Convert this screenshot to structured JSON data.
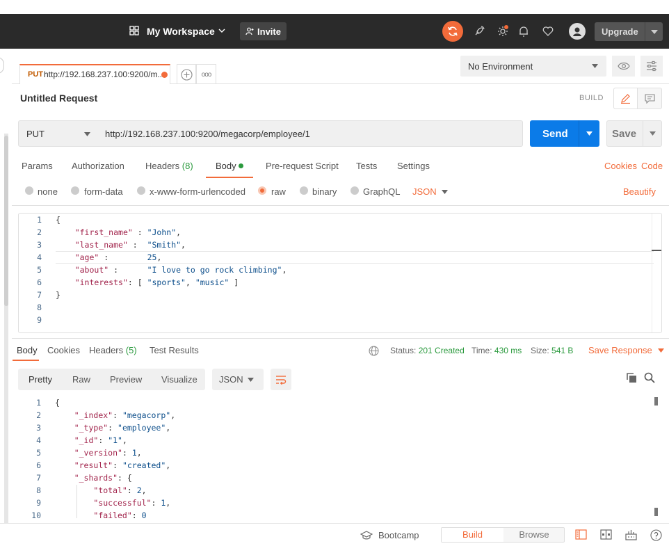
{
  "topbar": {
    "workspace_label": "My Workspace",
    "invite_label": "Invite",
    "upgrade_label": "Upgrade"
  },
  "tabs": [
    {
      "method": "PUT",
      "url": "http://192.168.237.100:9200/m..."
    }
  ],
  "tab_more": "ooo",
  "environment": {
    "selected": "No Environment"
  },
  "request": {
    "title": "Untitled Request",
    "build_label": "BUILD",
    "method": "PUT",
    "url": "http://192.168.237.100:9200/megacorp/employee/1",
    "send_label": "Send",
    "save_label": "Save"
  },
  "request_tabs": {
    "params": "Params",
    "authorization": "Authorization",
    "headers": "Headers",
    "headers_count": "(8)",
    "body": "Body",
    "prerequest": "Pre-request Script",
    "tests": "Tests",
    "settings": "Settings",
    "cookies": "Cookies",
    "code": "Code"
  },
  "body_types": {
    "none": "none",
    "form_data": "form-data",
    "urlencoded": "x-www-form-urlencoded",
    "raw": "raw",
    "binary": "binary",
    "graphql": "GraphQL",
    "language": "JSON",
    "beautify": "Beautify"
  },
  "request_body_lines": [
    {
      "n": "1",
      "parts": [
        [
          "p",
          "{"
        ]
      ]
    },
    {
      "n": "2",
      "parts": [
        [
          "p",
          "    "
        ],
        [
          "k",
          "\"first_name\""
        ],
        [
          "p",
          " : "
        ],
        [
          "s",
          "\"John\""
        ],
        [
          "p",
          ","
        ]
      ]
    },
    {
      "n": "3",
      "parts": [
        [
          "p",
          "    "
        ],
        [
          "k",
          "\"last_name\""
        ],
        [
          "p",
          " :  "
        ],
        [
          "s",
          "\"Smith\""
        ],
        [
          "p",
          ","
        ]
      ]
    },
    {
      "n": "4",
      "parts": [
        [
          "p",
          "    "
        ],
        [
          "k",
          "\"age\""
        ],
        [
          "p",
          " :        "
        ],
        [
          "n",
          "25"
        ],
        [
          "p",
          ","
        ]
      ]
    },
    {
      "n": "5",
      "parts": [
        [
          "p",
          "    "
        ],
        [
          "k",
          "\"about\""
        ],
        [
          "p",
          " :      "
        ],
        [
          "s",
          "\"I love to go rock climbing\""
        ],
        [
          "p",
          ","
        ]
      ]
    },
    {
      "n": "6",
      "parts": [
        [
          "p",
          "    "
        ],
        [
          "k",
          "\"interests\""
        ],
        [
          "p",
          ": [ "
        ],
        [
          "s",
          "\"sports\""
        ],
        [
          "p",
          ", "
        ],
        [
          "s",
          "\"music\""
        ],
        [
          "p",
          " ]"
        ]
      ]
    },
    {
      "n": "7",
      "parts": [
        [
          "p",
          "}"
        ]
      ]
    },
    {
      "n": "8",
      "parts": []
    },
    {
      "n": "9",
      "parts": []
    }
  ],
  "response_tabs": {
    "body": "Body",
    "cookies": "Cookies",
    "headers": "Headers",
    "headers_count": "(5)",
    "test_results": "Test Results"
  },
  "response_meta": {
    "status_label": "Status:",
    "status_value": "201 Created",
    "time_label": "Time:",
    "time_value": "430 ms",
    "size_label": "Size:",
    "size_value": "541 B",
    "save_response": "Save Response"
  },
  "response_view": {
    "pretty": "Pretty",
    "raw": "Raw",
    "preview": "Preview",
    "visualize": "Visualize",
    "format": "JSON"
  },
  "response_body_lines": [
    {
      "n": "1",
      "parts": [
        [
          "p",
          "{"
        ]
      ]
    },
    {
      "n": "2",
      "parts": [
        [
          "p",
          "    "
        ],
        [
          "k",
          "\"_index\""
        ],
        [
          "p",
          ": "
        ],
        [
          "s",
          "\"megacorp\""
        ],
        [
          "p",
          ","
        ]
      ]
    },
    {
      "n": "3",
      "parts": [
        [
          "p",
          "    "
        ],
        [
          "k",
          "\"_type\""
        ],
        [
          "p",
          ": "
        ],
        [
          "s",
          "\"employee\""
        ],
        [
          "p",
          ","
        ]
      ]
    },
    {
      "n": "4",
      "parts": [
        [
          "p",
          "    "
        ],
        [
          "k",
          "\"_id\""
        ],
        [
          "p",
          ": "
        ],
        [
          "s",
          "\"1\""
        ],
        [
          "p",
          ","
        ]
      ]
    },
    {
      "n": "5",
      "parts": [
        [
          "p",
          "    "
        ],
        [
          "k",
          "\"_version\""
        ],
        [
          "p",
          ": "
        ],
        [
          "n",
          "1"
        ],
        [
          "p",
          ","
        ]
      ]
    },
    {
      "n": "6",
      "parts": [
        [
          "p",
          "    "
        ],
        [
          "k",
          "\"result\""
        ],
        [
          "p",
          ": "
        ],
        [
          "s",
          "\"created\""
        ],
        [
          "p",
          ","
        ]
      ]
    },
    {
      "n": "7",
      "parts": [
        [
          "p",
          "    "
        ],
        [
          "k",
          "\"_shards\""
        ],
        [
          "p",
          ": {"
        ]
      ]
    },
    {
      "n": "8",
      "parts": [
        [
          "p",
          "        "
        ],
        [
          "k",
          "\"total\""
        ],
        [
          "p",
          ": "
        ],
        [
          "n",
          "2"
        ],
        [
          "p",
          ","
        ]
      ]
    },
    {
      "n": "9",
      "parts": [
        [
          "p",
          "        "
        ],
        [
          "k",
          "\"successful\""
        ],
        [
          "p",
          ": "
        ],
        [
          "n",
          "1"
        ],
        [
          "p",
          ","
        ]
      ]
    },
    {
      "n": "10",
      "parts": [
        [
          "p",
          "        "
        ],
        [
          "k",
          "\"failed\""
        ],
        [
          "p",
          ": "
        ],
        [
          "n",
          "0"
        ]
      ]
    }
  ],
  "statusbar": {
    "bootcamp": "Bootcamp",
    "build": "Build",
    "browse": "Browse"
  },
  "colors": {
    "accent": "#f26b3a",
    "primary": "#0b7be8",
    "topbar": "#2a2a2a",
    "success": "#2b9a3e"
  }
}
